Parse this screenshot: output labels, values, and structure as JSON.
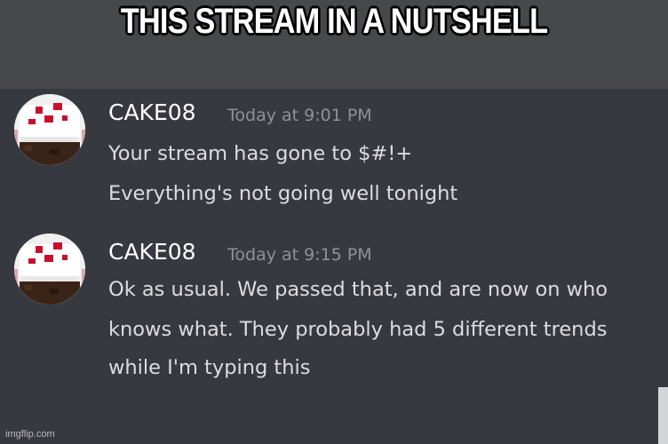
{
  "caption": "THIS STREAM IN A NUTSHELL",
  "messages": [
    {
      "username": "CAKE08",
      "timestamp": "Today at 9:01 PM",
      "lines": [
        "Your stream has gone to $#!+",
        "Everything's not going well tonight"
      ]
    },
    {
      "username": "CAKE08",
      "timestamp": "Today at 9:15 PM",
      "lines": [
        "Ok as usual. We passed that, and are now on who",
        "knows what. They probably had 5 different trends",
        "while I'm typing this"
      ]
    }
  ],
  "watermark": "imgflip.com",
  "colors": {
    "background": "#36393f",
    "caption_band": "#47484c",
    "username": "#ffffff",
    "timestamp": "#8e9297",
    "message_text": "#dcddde"
  },
  "icons": {
    "avatar": "cake-avatar-icon"
  }
}
